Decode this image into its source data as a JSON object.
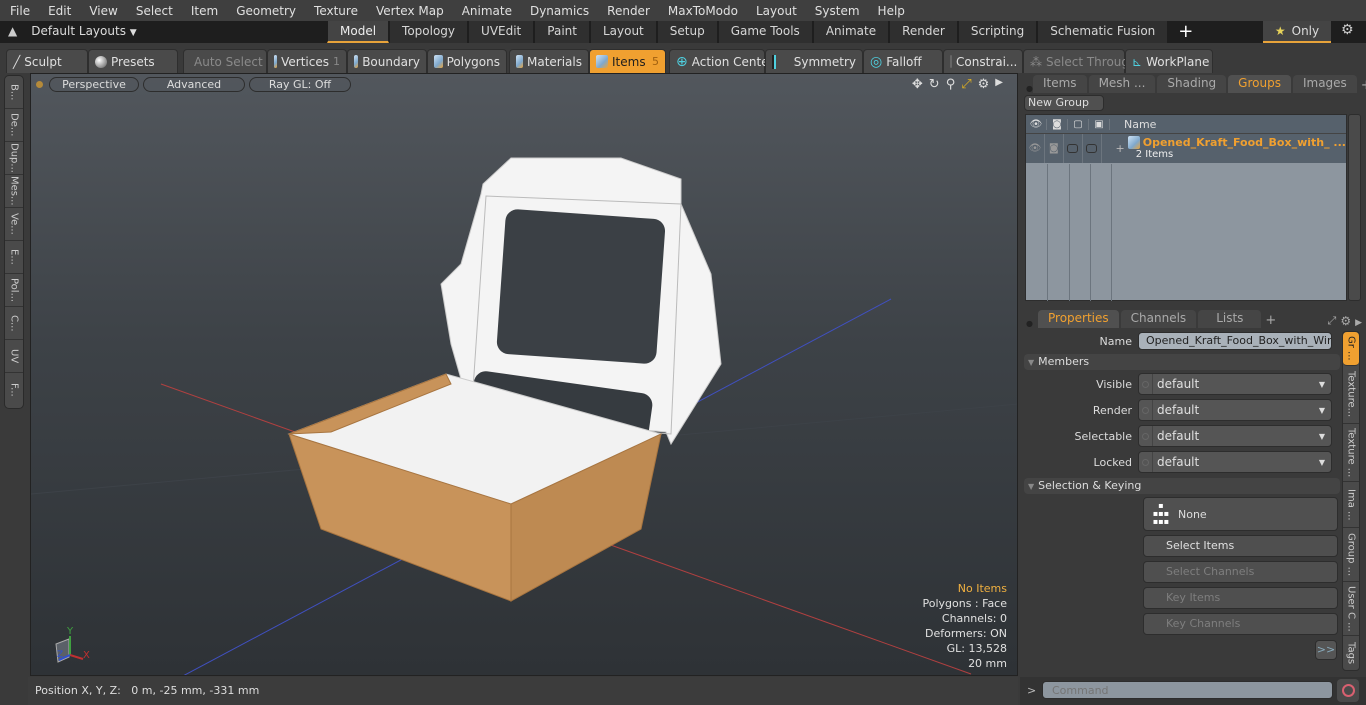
{
  "menu": [
    "File",
    "Edit",
    "View",
    "Select",
    "Item",
    "Geometry",
    "Texture",
    "Vertex Map",
    "Animate",
    "Dynamics",
    "Render",
    "MaxToModo",
    "Layout",
    "System",
    "Help"
  ],
  "layout_bar": {
    "layouts_label": "Default Layouts",
    "tabs": [
      "Model",
      "Topology",
      "UVEdit",
      "Paint",
      "Layout",
      "Setup",
      "Game Tools",
      "Animate",
      "Render",
      "Scripting",
      "Schematic Fusion"
    ],
    "active_tab": "Model",
    "only_label": "Only"
  },
  "toolbar": {
    "sculpt": "Sculpt",
    "presets": "Presets",
    "auto_select": "Auto Select",
    "vertices": "Vertices",
    "vertices_count": "1",
    "boundary": "Boundary",
    "polygons": "Polygons",
    "materials": "Materials",
    "items": "Items",
    "items_count": "5",
    "action_center": "Action Center",
    "symmetry": "Symmetry",
    "falloff": "Falloff",
    "constraints": "Constrai...",
    "select_through": "Select Through",
    "workplane": "WorkPlane"
  },
  "left_strip": [
    "B...",
    "De...",
    "Dup...",
    "Mes...",
    "Ve...",
    "E...",
    "Pol...",
    "C...",
    "UV",
    "F..."
  ],
  "viewport": {
    "view_mode": "Perspective",
    "shading": "Advanced",
    "raygl": "Ray GL: Off",
    "info": {
      "items": "No Items",
      "polygons": "Polygons : Face",
      "channels": "Channels: 0",
      "deformers": "Deformers: ON",
      "gl": "GL: 13,528",
      "scale": "20 mm"
    }
  },
  "status": {
    "position": "Position X, Y, Z:   0 m, -25 mm, -331 mm"
  },
  "groups_panel": {
    "tabs": [
      "Items",
      "Mesh ...",
      "Shading",
      "Groups",
      "Images"
    ],
    "active_tab": "Groups",
    "new_group": "New Group",
    "name_header": "Name",
    "group_name": "Opened_Kraft_Food_Box_with_ ...",
    "group_count": "2 Items"
  },
  "properties_panel": {
    "tabs": [
      "Properties",
      "Channels",
      "Lists"
    ],
    "active_tab": "Properties",
    "name_label": "Name",
    "name_value": "Opened_Kraft_Food_Box_with_Windo",
    "members_section": "Members",
    "fields": [
      {
        "label": "Visible",
        "value": "default"
      },
      {
        "label": "Render",
        "value": "default"
      },
      {
        "label": "Selectable",
        "value": "default"
      },
      {
        "label": "Locked",
        "value": "default"
      }
    ],
    "selection_section": "Selection & Keying",
    "none_label": "None",
    "select_items": "Select Items",
    "select_channels": "Select Channels",
    "key_items": "Key Items",
    "key_channels": "Key Channels",
    "more": ">>",
    "side_tabs": [
      "Gr ...",
      "Texture...",
      "Texture ...",
      "Ima ...",
      "Group ...",
      "User C ...",
      "Tags"
    ]
  },
  "command": {
    "prompt": ">",
    "placeholder": "Command"
  },
  "colors": {
    "accent": "#f0a030",
    "kraft": "#c8935a"
  }
}
